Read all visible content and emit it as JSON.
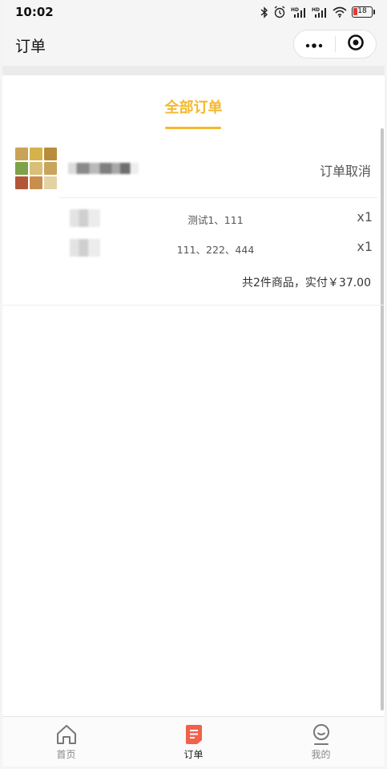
{
  "status_bar": {
    "time": "10:02",
    "battery": "18",
    "icons": [
      "bluetooth-icon",
      "alarm-icon",
      "signal-hd-icon",
      "signal-hd-icon",
      "wifi-icon",
      "battery-icon"
    ]
  },
  "nav": {
    "title": "订单",
    "more_icon": "more-dots-icon",
    "close_icon": "target-close-icon"
  },
  "tabs": [
    {
      "label": "全部订单",
      "active": true
    }
  ],
  "orders": [
    {
      "status": "订单取消",
      "items": [
        {
          "spec": "测试1、111",
          "qty": "x1"
        },
        {
          "spec": "111、222、444",
          "qty": "x1"
        }
      ],
      "summary": "共2件商品，实付￥37.00"
    }
  ],
  "tabbar": [
    {
      "label": "首页",
      "icon": "home-icon",
      "active": false
    },
    {
      "label": "订单",
      "icon": "order-icon",
      "active": true
    },
    {
      "label": "我的",
      "icon": "profile-icon",
      "active": false
    }
  ],
  "colors": {
    "accent": "#f5b82e",
    "order_icon": "#f0624b",
    "battery_low": "#e53935"
  }
}
